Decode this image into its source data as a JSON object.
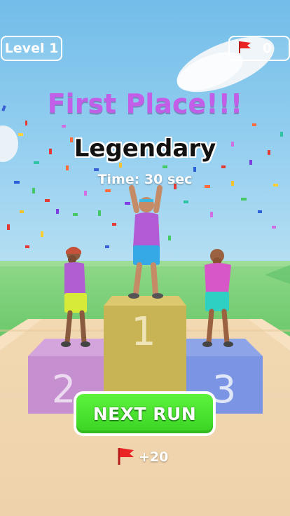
{
  "hud": {
    "level_label": "Level 1",
    "flag_count": "0",
    "flag_icon": "red-flag-icon"
  },
  "results": {
    "headline": "First Place!!!",
    "rank_title": "Legendary",
    "time_text": "Time:  30 sec"
  },
  "podium": {
    "first": "1",
    "second": "2",
    "third": "3"
  },
  "next_button": {
    "label": "NEXT RUN"
  },
  "reward": {
    "amount": "+20",
    "icon": "red-flag-icon"
  },
  "colors": {
    "sky": "#86c8ec",
    "headline": "#c35ee8",
    "button_green": "#4be430",
    "podium_first": "#c9b455",
    "podium_second": "#c68fcf",
    "podium_third": "#7b94e3",
    "flag": "#e82424"
  }
}
